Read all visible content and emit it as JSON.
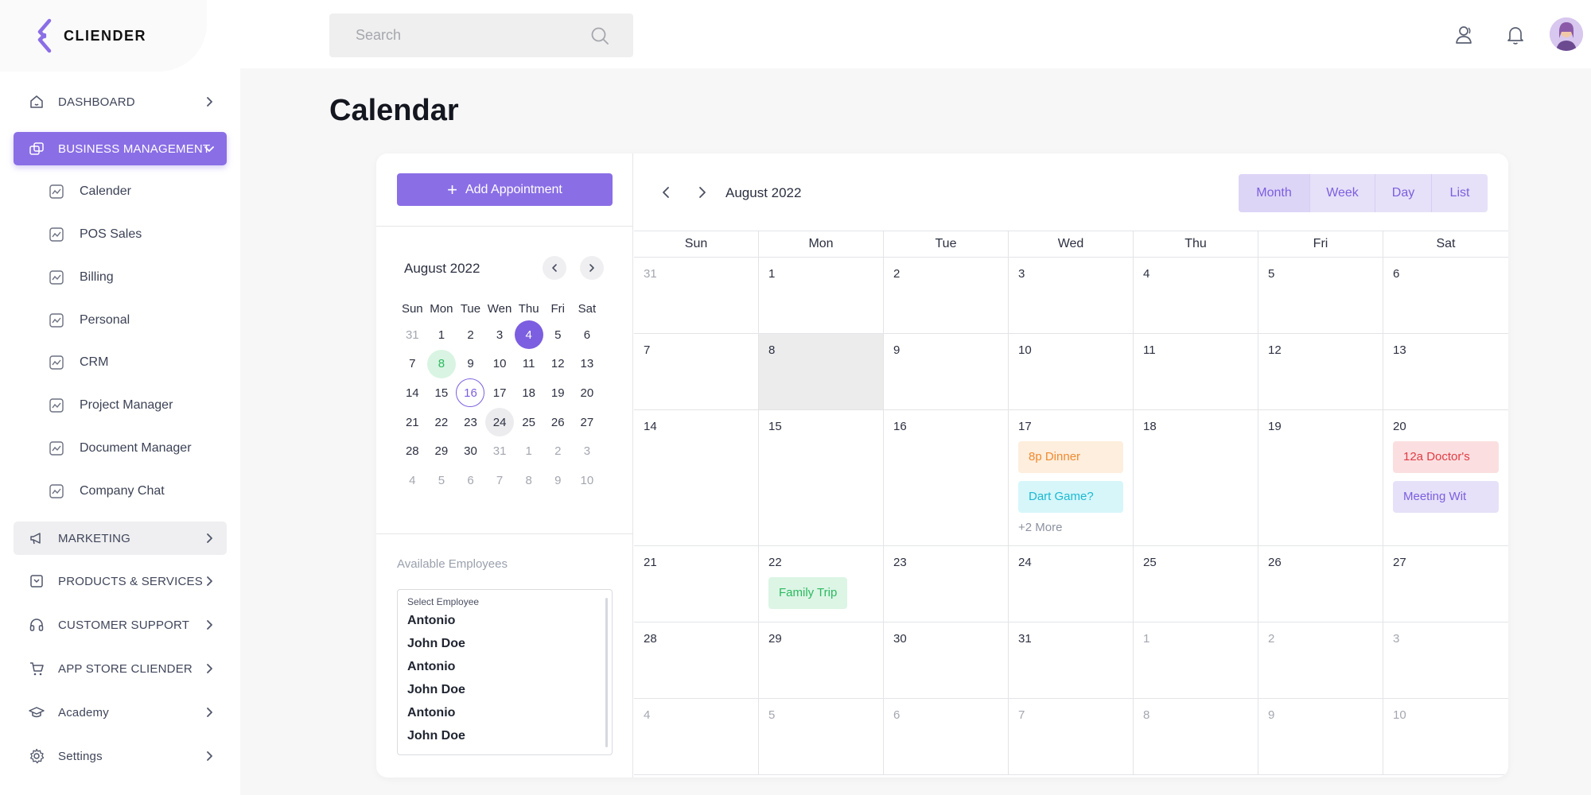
{
  "brand": {
    "name": "CLIENDER"
  },
  "colors": {
    "accent": "#8a6ee6",
    "accent_dark": "#7c5ee0"
  },
  "search": {
    "placeholder": "Search"
  },
  "sidebar": {
    "dashboard": "DASHBOARD",
    "business": "BUSINESS MANAGEMENT",
    "sub_items": [
      "Calender",
      "POS Sales",
      "Billing",
      "Personal",
      "CRM",
      "Project Manager",
      "Document Manager",
      "Company Chat"
    ],
    "marketing": "MARKETING",
    "products": "PRODUCTS & SERVICES",
    "support": "CUSTOMER SUPPORT",
    "appstore": "APP STORE CLIENDER",
    "academy": "Academy",
    "settings": "Settings"
  },
  "page_title": "Calendar",
  "left_panel": {
    "add_button": "Add Appointment",
    "mini_month": "August 2022",
    "mini_weekdays": [
      "Sun",
      "Mon",
      "Tue",
      "Wen",
      "Thu",
      "Fri",
      "Sat"
    ],
    "mini_weeks": [
      [
        "31",
        "1",
        "2",
        "3",
        "4",
        "5",
        "6"
      ],
      [
        "7",
        "8",
        "9",
        "10",
        "11",
        "12",
        "13"
      ],
      [
        "14",
        "15",
        "16",
        "17",
        "18",
        "19",
        "20"
      ],
      [
        "21",
        "22",
        "23",
        "24",
        "25",
        "26",
        "27"
      ],
      [
        "28",
        "29",
        "30",
        "31",
        "1",
        "2",
        "3"
      ],
      [
        "4",
        "5",
        "6",
        "7",
        "8",
        "9",
        "10"
      ]
    ],
    "employees_label": "Available Employees",
    "employee_caption": "Select Employee",
    "employees": [
      "Antonio",
      "John Doe",
      "Antonio",
      "John Doe",
      "Antonio",
      "John Doe"
    ]
  },
  "calendar": {
    "month": "August 2022",
    "views": [
      "Month",
      "Week",
      "Day",
      "List"
    ],
    "active_view": "Month",
    "weekdays": [
      "Sun",
      "Mon",
      "Tue",
      "Wed",
      "Thu",
      "Fri",
      "Sat"
    ],
    "weeks": [
      [
        "31",
        "1",
        "2",
        "3",
        "4",
        "5",
        "6"
      ],
      [
        "7",
        "8",
        "9",
        "10",
        "11",
        "12",
        "13"
      ],
      [
        "14",
        "15",
        "16",
        "17",
        "18",
        "19",
        "20"
      ],
      [
        "21",
        "22",
        "23",
        "24",
        "25",
        "26",
        "27"
      ],
      [
        "28",
        "29",
        "30",
        "31",
        "1",
        "2",
        "3"
      ],
      [
        "4",
        "5",
        "6",
        "7",
        "8",
        "9",
        "10"
      ]
    ],
    "events": {
      "dinner": "8p Dinner",
      "dart": "Dart Game?",
      "more": "+2 More",
      "doctor": "12a Doctor's",
      "meeting": "Meeting Wit",
      "family": "Family Trip"
    },
    "event_colors": {
      "dinner": {
        "bg": "#fdeedd",
        "fg": "#ef8a2f"
      },
      "dart": {
        "bg": "#d6f6fa",
        "fg": "#1bb9d2"
      },
      "doctor": {
        "bg": "#fbdfe0",
        "fg": "#e13b45"
      },
      "meeting": {
        "bg": "#e6e1f8",
        "fg": "#7c5ee0"
      },
      "family": {
        "bg": "#dcf5e5",
        "fg": "#2cb960"
      }
    }
  }
}
